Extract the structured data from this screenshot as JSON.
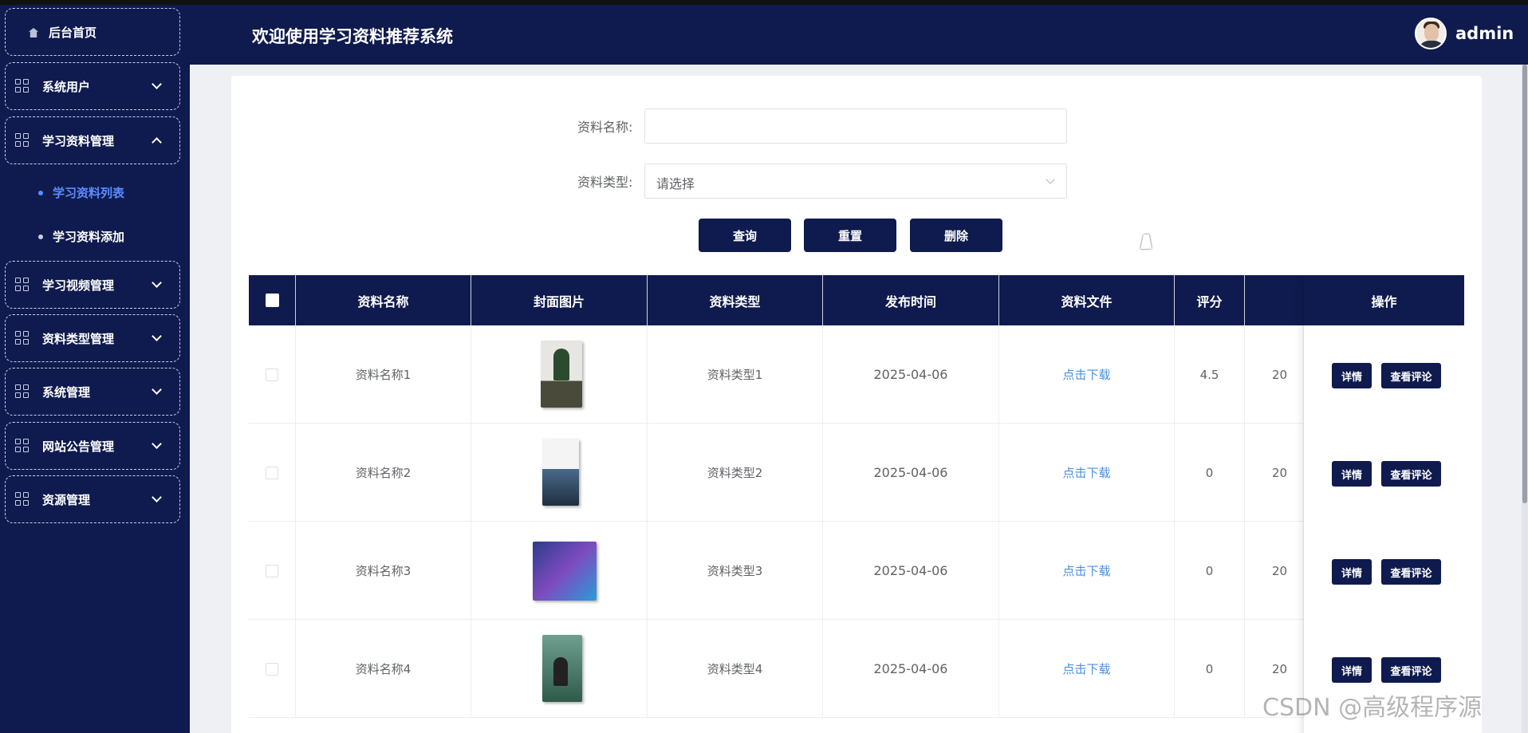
{
  "app": {
    "title": "欢迎使用学习资料推荐系统",
    "user": "admin"
  },
  "sidebar": {
    "home": "后台首页",
    "items": [
      {
        "label": "系统用户",
        "expanded": false
      },
      {
        "label": "学习资料管理",
        "expanded": true
      },
      {
        "label": "学习视频管理",
        "expanded": false
      },
      {
        "label": "资料类型管理",
        "expanded": false
      },
      {
        "label": "系统管理",
        "expanded": false
      },
      {
        "label": "网站公告管理",
        "expanded": false
      },
      {
        "label": "资源管理",
        "expanded": false
      }
    ],
    "subitems": [
      {
        "label": "学习资料列表",
        "active": true
      },
      {
        "label": "学习资料添加",
        "active": false
      }
    ]
  },
  "search": {
    "name_label": "资料名称:",
    "name_value": "",
    "type_label": "资料类型:",
    "type_value": "请选择",
    "query_btn": "查询",
    "reset_btn": "重置",
    "delete_btn": "删除"
  },
  "table": {
    "columns": [
      "资料名称",
      "封面图片",
      "资料类型",
      "发布时间",
      "资料文件",
      "评分",
      "操作"
    ],
    "rows": [
      {
        "name": "资料名称1",
        "type": "资料类型1",
        "date": "2025-04-06",
        "file": "点击下载",
        "score": "4.5",
        "extra": "20",
        "cover": "book-cover-1"
      },
      {
        "name": "资料名称2",
        "type": "资料类型2",
        "date": "2025-04-06",
        "file": "点击下载",
        "score": "0",
        "extra": "20",
        "cover": "book-cover-2"
      },
      {
        "name": "资料名称3",
        "type": "资料类型3",
        "date": "2025-04-06",
        "file": "点击下载",
        "score": "0",
        "extra": "20",
        "cover": "book-cover-3"
      },
      {
        "name": "资料名称4",
        "type": "资料类型4",
        "date": "2025-04-06",
        "file": "点击下载",
        "score": "0",
        "extra": "20",
        "cover": "book-cover-4"
      }
    ],
    "detail_btn": "详情",
    "comment_btn": "查看评论"
  },
  "watermark": "CSDN @高级程序源",
  "colors": {
    "navy": "#0f1b4e",
    "active_link": "#5b8dff",
    "download_link": "#4a90e2"
  }
}
